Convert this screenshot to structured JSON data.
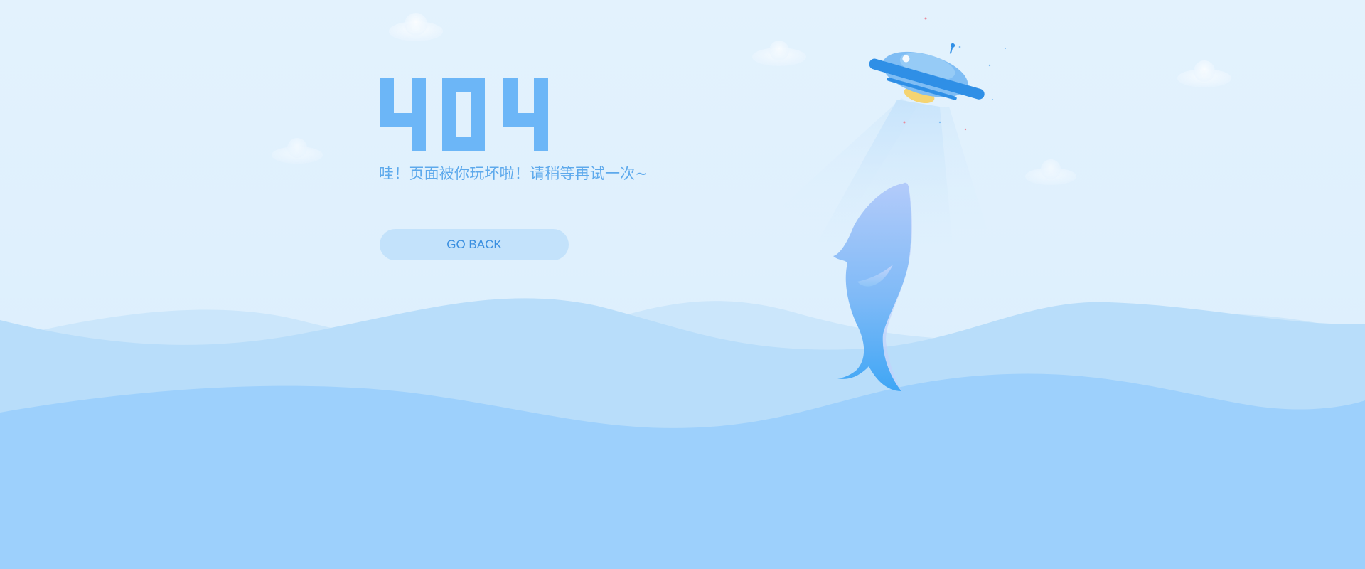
{
  "error_page": {
    "code": "404",
    "message": "哇！页面被你玩坏啦！请稍等再试一次~",
    "button_label": "GO BACK"
  },
  "colors": {
    "background": "#e1f1fd",
    "digits": "#6cb6f7",
    "message_text": "#5da9ec",
    "button_bg": "#c3e2fb",
    "button_text": "#3a8fe0",
    "wave_light": "#cbe6fb",
    "wave_mid": "#b4dbfa",
    "wave_front": "#9dd0fc",
    "ufo_body": "#7fbdf4",
    "ufo_ring": "#2f8fe6",
    "ufo_light": "#f5d472",
    "fish_top": "#b6cdfa",
    "fish_bottom": "#42a9f6"
  },
  "icons": {
    "ufo": "ufo-icon",
    "fish": "whale-icon",
    "cloud": "cloud-icon"
  }
}
